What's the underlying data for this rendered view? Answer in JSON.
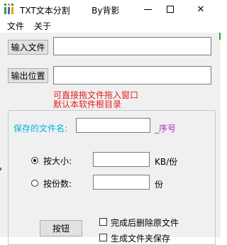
{
  "window": {
    "title": "TXT文本分割        By背影",
    "minimize_icon": "minimize-icon",
    "maximize_icon": "maximize-icon",
    "close_glyph": "✕"
  },
  "menu": {
    "items": [
      {
        "label": "文件"
      },
      {
        "label": "关于"
      }
    ]
  },
  "io": {
    "input_button": "输入文件",
    "input_value": "",
    "output_button": "输出位置",
    "output_value": "",
    "hint_line1": "可直接拖文件拖入窗口",
    "hint_line2": "默认本软件根目录"
  },
  "options": {
    "save_name_label": "保存的文件名:",
    "save_name_value": "",
    "sequence_label": "_序号",
    "by_size_label": "按大小:",
    "by_size_value": "",
    "by_size_unit": "KB/份",
    "by_size_checked": true,
    "by_copies_label": "按份数:",
    "by_copies_value": "",
    "by_copies_unit": "份",
    "by_copies_checked": false
  },
  "actions": {
    "run_button": "按钮",
    "delete_after_label": "完成后删除原文件",
    "delete_after_checked": false,
    "make_folder_label": "生成文件夹保存",
    "make_folder_checked": false
  },
  "colors": {
    "hint": "#e02020",
    "save_name_label": "#00b4e0",
    "sequence_label": "#b030c0"
  }
}
